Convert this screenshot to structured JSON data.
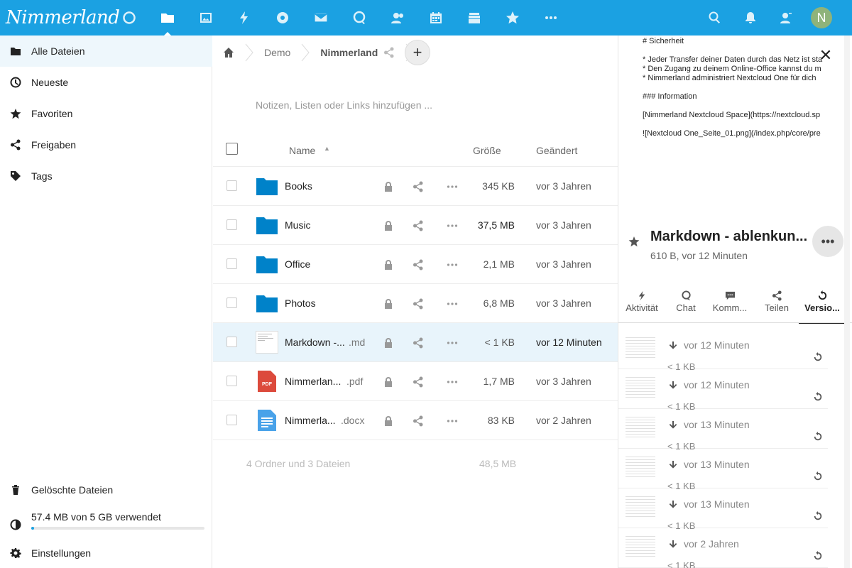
{
  "header": {
    "logo_text": "Nimmerland",
    "avatar_letter": "N",
    "brand_color": "#1ba1e2",
    "apps": [
      "dashboard-icon",
      "files-icon",
      "photos-icon",
      "activity-icon",
      "talk-icon",
      "mail-icon",
      "search-circle-icon",
      "contacts-icon",
      "calendar-icon",
      "deck-icon",
      "favorites-icon",
      "more-apps-icon"
    ],
    "right_icons": [
      "search-icon",
      "notifications-icon",
      "contacts-menu-icon"
    ]
  },
  "nav": {
    "items": [
      {
        "label": "Alle Dateien",
        "icon": "folder-icon"
      },
      {
        "label": "Neueste",
        "icon": "clock-icon"
      },
      {
        "label": "Favoriten",
        "icon": "star-icon"
      },
      {
        "label": "Freigaben",
        "icon": "share-icon"
      },
      {
        "label": "Tags",
        "icon": "tag-icon"
      }
    ],
    "trash": "Gelöschte Dateien",
    "quota": "57.4 MB von 5 GB verwendet",
    "quota_fraction": 0.011,
    "settings": "Einstellungen"
  },
  "breadcrumb": {
    "items": [
      "Demo",
      "Nimmerland"
    ]
  },
  "notes_placeholder": "Notizen, Listen oder Links hinzufügen ...",
  "table": {
    "col_name": "Name",
    "col_size": "Größe",
    "col_modified": "Geändert",
    "rows": [
      {
        "name": "Books",
        "ext": "",
        "size": "345 KB",
        "modified": "vor 3 Jahren",
        "type": "folder"
      },
      {
        "name": "Music",
        "ext": "",
        "size": "37,5 MB",
        "modified": "vor 3 Jahren",
        "type": "folder"
      },
      {
        "name": "Office",
        "ext": "",
        "size": "2,1 MB",
        "modified": "vor 3 Jahren",
        "type": "folder"
      },
      {
        "name": "Photos",
        "ext": "",
        "size": "6,8 MB",
        "modified": "vor 3 Jahren",
        "type": "folder"
      },
      {
        "name": "Markdown -...",
        "ext": ".md",
        "size": "< 1 KB",
        "modified": "vor 12 Minuten",
        "type": "md"
      },
      {
        "name": "Nimmerlan...",
        "ext": ".pdf",
        "size": "1,7 MB",
        "modified": "vor 3 Jahren",
        "type": "pdf"
      },
      {
        "name": "Nimmerla...",
        "ext": ".docx",
        "size": "83 KB",
        "modified": "vor 2 Jahren",
        "type": "docx"
      }
    ],
    "summary": "4 Ordner und 3 Dateien",
    "summary_size": "48,5 MB"
  },
  "sidebar": {
    "preview_lines": [
      "# Sicherheit",
      "",
      "* Jeder Transfer deiner Daten durch das Netz ist sta",
      "* Den Zugang zu deinem Online-Office kannst du m",
      "* Nimmerland administriert Nextcloud One für dich",
      "",
      "### Information",
      "",
      "[Nimmerland Nextcloud Space](https://nextcloud.sp",
      "",
      "![Nextcloud One_Seite_01.png](/index.php/core/pre"
    ],
    "title": "Markdown - ablenkun...",
    "subtitle": "610 B, vor 12 Minuten",
    "tabs": [
      {
        "label": "Aktivität",
        "icon": "activity-icon"
      },
      {
        "label": "Chat",
        "icon": "chat-icon"
      },
      {
        "label": "Komm...",
        "icon": "comments-icon"
      },
      {
        "label": "Teilen",
        "icon": "share-icon"
      },
      {
        "label": "Versio...",
        "icon": "history-icon"
      }
    ],
    "versions": [
      {
        "time": "vor 12 Minuten",
        "size": "< 1 KB"
      },
      {
        "time": "vor 12 Minuten",
        "size": "< 1 KB"
      },
      {
        "time": "vor 13 Minuten",
        "size": "< 1 KB"
      },
      {
        "time": "vor 13 Minuten",
        "size": "< 1 KB"
      },
      {
        "time": "vor 13 Minuten",
        "size": "< 1 KB"
      },
      {
        "time": "vor 2 Jahren",
        "size": "< 1 KB"
      }
    ]
  }
}
